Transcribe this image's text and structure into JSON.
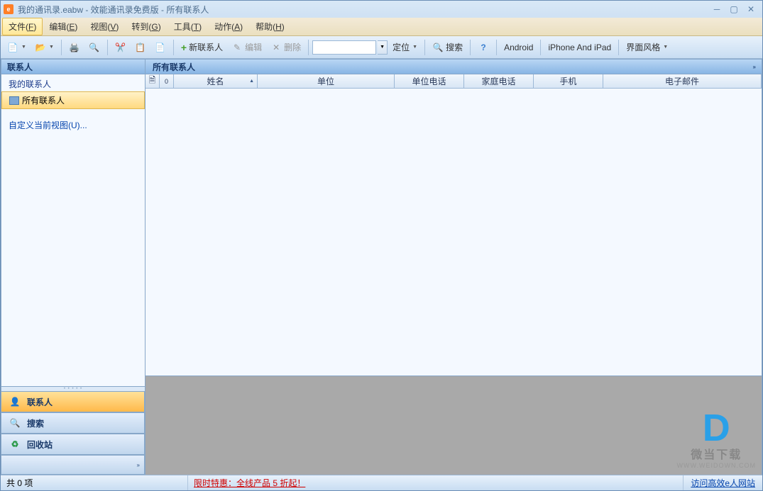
{
  "title": "我的通讯录.eabw - 效能通讯录免费版 - 所有联系人",
  "menu": [
    {
      "label": "文件(",
      "key": "F",
      "tail": ")",
      "active": true
    },
    {
      "label": "编辑(",
      "key": "E",
      "tail": ")"
    },
    {
      "label": "视图(",
      "key": "V",
      "tail": ")"
    },
    {
      "label": "转到(",
      "key": "G",
      "tail": ")"
    },
    {
      "label": "工具(",
      "key": "T",
      "tail": ")"
    },
    {
      "label": "动作(",
      "key": "A",
      "tail": ")"
    },
    {
      "label": "帮助(",
      "key": "H",
      "tail": ")"
    }
  ],
  "toolbar": {
    "new_contact": "新联系人",
    "edit": "编辑",
    "delete": "删除",
    "locate": "定位",
    "search": "搜索",
    "android": "Android",
    "iphone_ipad": "iPhone And iPad",
    "style": "界面风格"
  },
  "sidebar": {
    "header": "联系人",
    "root": "我的联系人",
    "all_contacts": "所有联系人",
    "customize_view": "自定义当前视图(U)...",
    "nav": {
      "contacts": "联系人",
      "search": "搜索",
      "recycle": "回收站"
    }
  },
  "content": {
    "header": "所有联系人",
    "columns": [
      "姓名",
      "单位",
      "单位电话",
      "家庭电话",
      "手机",
      "电子邮件"
    ]
  },
  "watermark": {
    "text": "微当下载",
    "url": "WWW.WEIDOWN.COM"
  },
  "status": {
    "count": "共 0 项",
    "promo": "限时特惠：全线产品 5 折起！",
    "site": "访问高效e人网站"
  }
}
